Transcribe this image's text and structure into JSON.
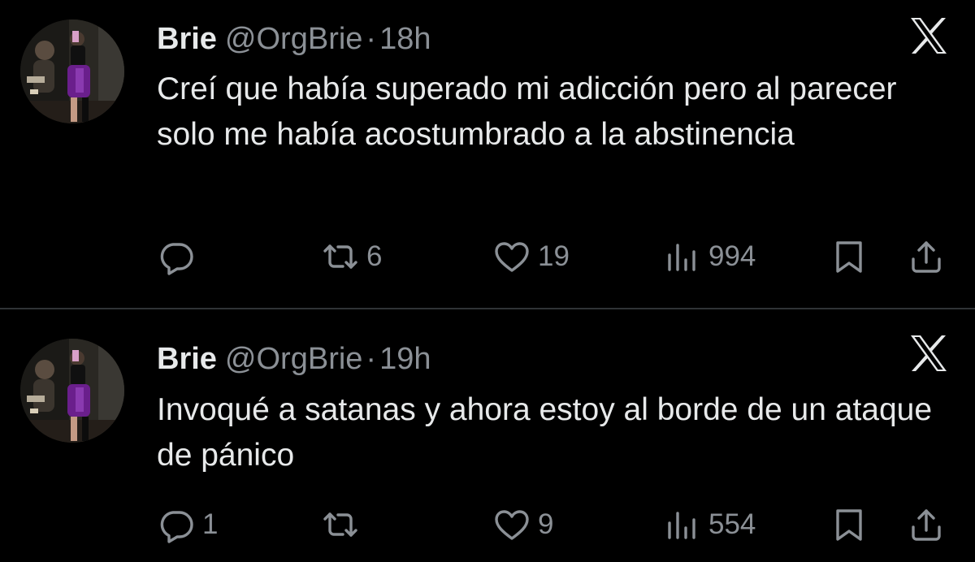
{
  "tweets": [
    {
      "author_name": "Brie",
      "handle": "@OrgBrie",
      "separator": "·",
      "time": "18h",
      "text": "Creí que había superado mi adicción pero al parecer solo me había acostumbrado a la abstinencia",
      "replies": "",
      "retweets": "6",
      "likes": "19",
      "views": "994"
    },
    {
      "author_name": "Brie",
      "handle": "@OrgBrie",
      "separator": "·",
      "time": "19h",
      "text": "Invoqué a satanas y ahora estoy al borde de un ataque de pánico",
      "replies": "1",
      "retweets": "",
      "likes": "9",
      "views": "554"
    }
  ],
  "icons": {
    "brand": "x-logo-icon",
    "reply": "reply-icon",
    "retweet": "retweet-icon",
    "like": "heart-icon",
    "views": "views-chart-icon",
    "bookmark": "bookmark-icon",
    "share": "share-icon"
  },
  "colors": {
    "background": "#000000",
    "text_primary": "#e7e9ea",
    "text_secondary": "#8b9096",
    "divider": "#2f3336",
    "avatar_dress": "#6a1f8c"
  }
}
